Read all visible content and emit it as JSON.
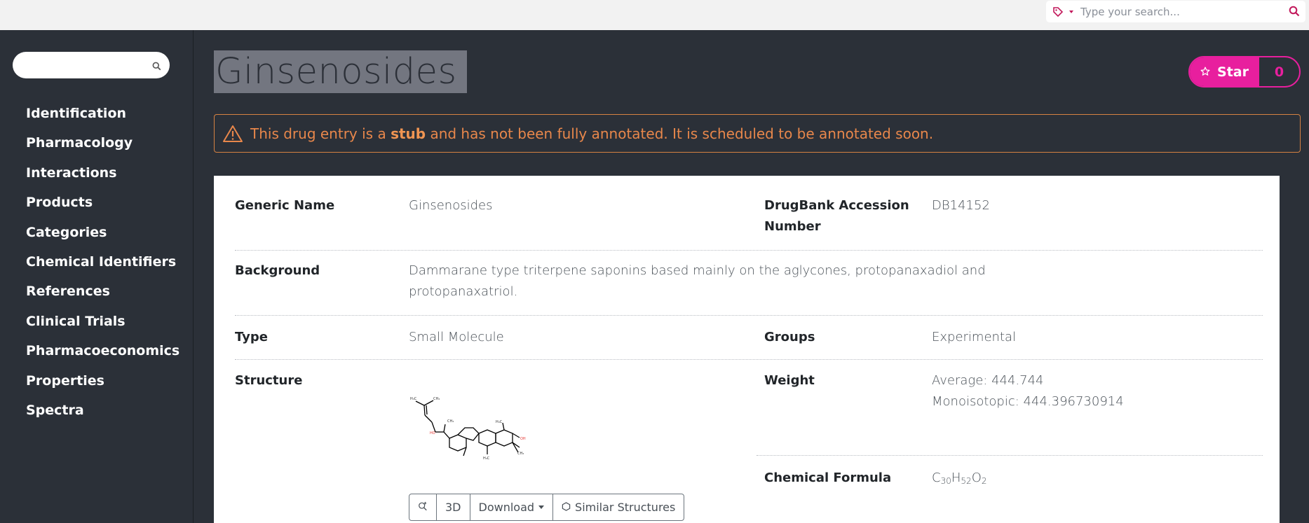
{
  "top_search": {
    "placeholder": "Type your search..."
  },
  "sidebar": {
    "search_placeholder": "",
    "items": [
      {
        "label": "Identification"
      },
      {
        "label": "Pharmacology"
      },
      {
        "label": "Interactions"
      },
      {
        "label": "Products"
      },
      {
        "label": "Categories"
      },
      {
        "label": "Chemical Identifiers"
      },
      {
        "label": "References"
      },
      {
        "label": "Clinical Trials"
      },
      {
        "label": "Pharmacoeconomics"
      },
      {
        "label": "Properties"
      },
      {
        "label": "Spectra"
      }
    ]
  },
  "header": {
    "title": "Ginsenosides",
    "star_label": "Star",
    "star_count": "0"
  },
  "alert": {
    "text_before": "This drug entry is a ",
    "text_bold": "stub",
    "text_after": " and has not been fully annotated. It is scheduled to be annotated soon."
  },
  "details": {
    "generic_name_label": "Generic Name",
    "generic_name_value": "Ginsenosides",
    "accession_label_1": "DrugBank Accession",
    "accession_label_2": "Number",
    "accession_value": "DB14152",
    "background_label": "Background",
    "background_line_1": "Dammarane type triterpene saponins based mainly on the aglycones, protopanaxadiol and",
    "background_line_2": "protopanaxatriol.",
    "type_label": "Type",
    "type_value": "Small Molecule",
    "groups_label": "Groups",
    "groups_value": "Experimental",
    "structure_label": "Structure",
    "weight_label": "Weight",
    "weight_average": "Average: 444.744",
    "weight_mono": "Monoisotopic: 444.396730914",
    "formula_label": "Chemical Formula",
    "formula": {
      "c": "C",
      "c_n": "30",
      "h": "H",
      "h_n": "52",
      "o": "O",
      "o_n": "2"
    }
  },
  "structure_buttons": {
    "threed": "3D",
    "download": "Download",
    "similar": "Similar Structures"
  },
  "colors": {
    "accent": "#e81f9e",
    "warning": "#e8874b",
    "background": "#2b3038"
  }
}
